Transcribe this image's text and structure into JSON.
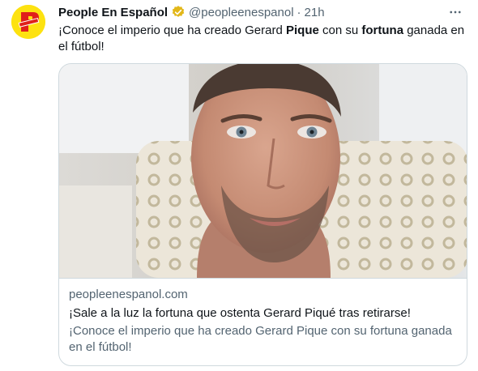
{
  "tweet": {
    "display_name": "People En Español",
    "handle": "@peopleenespanol",
    "separator": "·",
    "time": "21h",
    "text_parts": {
      "p1": "¡Conoce el imperio que ha creado Gerard ",
      "b1": "Pique",
      "p2": " con su ",
      "b2": "fortuna",
      "p3": " ganada en el fútbol!"
    },
    "icons": {
      "avatar": "people-logo-icon",
      "verified": "verified-badge-icon",
      "more": "more-icon"
    },
    "colors": {
      "verified": "#e2b719",
      "avatar_bg": "#fde210",
      "avatar_logo": "#e0201b"
    }
  },
  "card": {
    "domain": "peopleenespanol.com",
    "title": "¡Sale a la luz la fortuna que ostenta Gerard Piqué tras retirarse!",
    "description": "¡Conoce el imperio que ha creado Gerard Pique con su fortuna ganada en el fútbol!"
  }
}
